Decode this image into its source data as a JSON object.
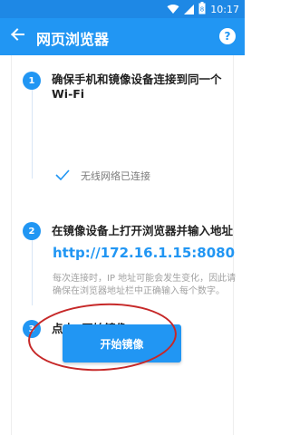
{
  "status_bar": {
    "time": "10:17",
    "battery_level": "8",
    "icons": [
      "wifi-icon",
      "signal-icon",
      "battery-icon"
    ]
  },
  "app_bar": {
    "title": "网页浏览器",
    "back_icon": "back-arrow-icon",
    "help_label": "?"
  },
  "steps": [
    {
      "number": "1",
      "title": "确保手机和镜像设备连接到同一个Wi-Fi",
      "status_text": "无线网络已连接"
    },
    {
      "number": "2",
      "title": "在镜像设备上打开浏览器并输入地址",
      "url": "http://172.16.1.15:8080",
      "note": "每次连接时，IP 地址可能会发生变化，因此请确保在浏览器地址栏中正确输入每个数字。"
    },
    {
      "number": "3",
      "title": "点击“开始镜像”"
    }
  ],
  "start_button": {
    "label": "开始镜像"
  },
  "colors": {
    "primary": "#2196f3",
    "status_bar": "#1e88e5",
    "annotation": "#c62828"
  }
}
